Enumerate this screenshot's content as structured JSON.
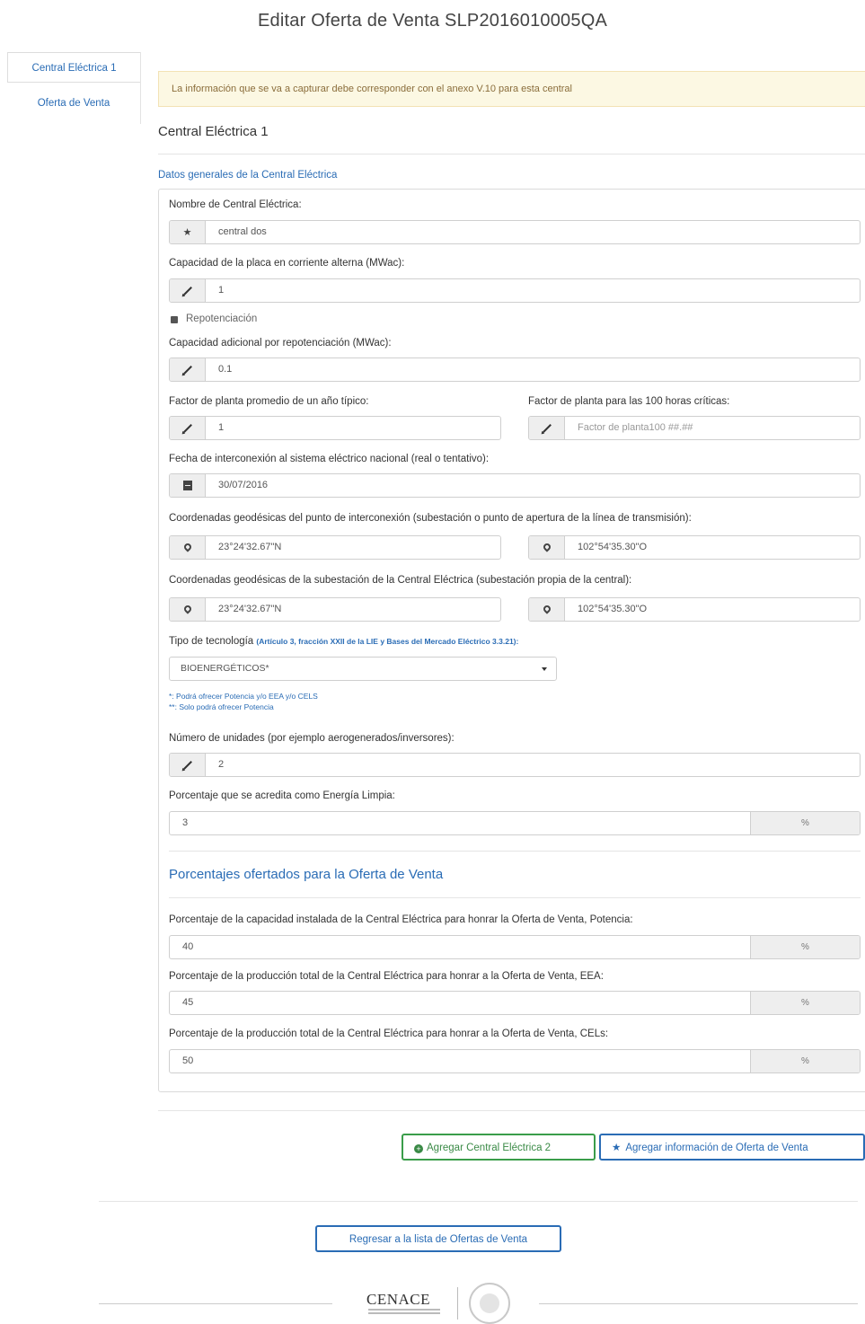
{
  "page": {
    "title": "Editar Oferta de Venta SLP2016010005QA"
  },
  "sidebar": {
    "items": [
      {
        "label": "Central Eléctrica 1",
        "active": true
      },
      {
        "label": "Oferta de Venta",
        "active": false
      }
    ]
  },
  "alert": {
    "text": "La información que se va a capturar debe corresponder con el anexo V.10 para esta central"
  },
  "central": {
    "heading": "Central Eléctrica 1",
    "section_link": "Datos generales de la Central Eléctrica"
  },
  "form": {
    "nombre": {
      "label": "Nombre de Central Eléctrica:",
      "value": "central dos",
      "icon": "star-icon"
    },
    "capacidad": {
      "label": "Capacidad de la placa en corriente alterna (MWac):",
      "value": "1",
      "icon": "pencil-icon"
    },
    "repotenciacion": {
      "label": "Repotenciación",
      "checked": true
    },
    "capacidad_adicional": {
      "label": "Capacidad adicional por repotenciación (MWac):",
      "value": "0.1",
      "icon": "pencil-icon"
    },
    "factor_promedio": {
      "label": "Factor de planta promedio de un año típico:",
      "value": "1",
      "icon": "pencil-icon"
    },
    "factor_100": {
      "label": "Factor de planta para las 100 horas críticas:",
      "placeholder": "Factor de planta100 ##.##",
      "icon": "pencil-icon"
    },
    "fecha": {
      "label": "Fecha de interconexión al sistema eléctrico nacional (real o tentativo):",
      "value": "30/07/2016",
      "icon": "calendar-icon"
    },
    "coord_interconexion": {
      "label": "Coordenadas geodésicas del punto de interconexión (subestación o punto de apertura de la línea de transmisión):",
      "lat": "23°24'32.67\"N",
      "lon": "102°54'35.30\"O",
      "icon": "map-marker-icon"
    },
    "coord_subestacion": {
      "label": "Coordenadas geodésicas de la subestación de la Central Eléctrica (subestación propia de la central):",
      "lat": "23°24'32.67\"N",
      "lon": "102°54'35.30\"O",
      "icon": "map-marker-icon"
    },
    "tecnologia": {
      "label": "Tipo de tecnología",
      "hint": "(Artículo 3, fracción XXII de la LIE y Bases del Mercado Eléctrico 3.3.21):",
      "value": "BIOENERGÉTICOS*",
      "note1": "*: Podrá ofrecer Potencia y/o EEA y/o CELS",
      "note2": "**: Solo podrá ofrecer Potencia"
    },
    "unidades": {
      "label": "Número de unidades (por ejemplo aerogenerados/inversores):",
      "value": "2",
      "icon": "pencil-icon"
    },
    "energia_limpia": {
      "label": "Porcentaje que se acredita como Energía Limpia:",
      "value": "3",
      "unit": "%"
    }
  },
  "porcentajes": {
    "heading": "Porcentajes ofertados para la Oferta de Venta",
    "potencia": {
      "label": "Porcentaje de la capacidad instalada de la Central Eléctrica para honrar la Oferta de Venta, Potencia:",
      "value": "40",
      "unit": "%"
    },
    "eea": {
      "label": "Porcentaje de la producción total de la Central Eléctrica para honrar a la Oferta de Venta, EEA:",
      "value": "45",
      "unit": "%"
    },
    "cels": {
      "label": "Porcentaje de la producción total de la Central Eléctrica para honrar a la Oferta de Venta, CELs:",
      "value": "50",
      "unit": "%"
    }
  },
  "actions": {
    "add_central": "Agregar Central Eléctrica 2",
    "add_info": "Agregar información de Oferta de Venta",
    "back": "Regresar a la lista de Ofertas de Venta"
  },
  "footer": {
    "logo_text": "CENACE"
  },
  "colors": {
    "link": "#2a6cb5",
    "success": "#3a9d4a",
    "alert_bg": "#fcf8e3"
  }
}
